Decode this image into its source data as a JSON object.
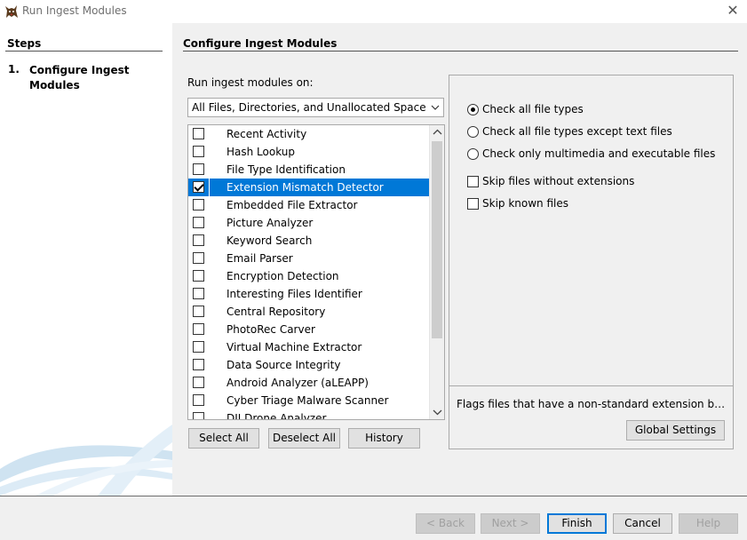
{
  "window": {
    "title": "Run Ingest Modules",
    "close_glyph": "✕"
  },
  "steps": {
    "title": "Steps",
    "items": [
      {
        "num": "1.",
        "label": "Configure Ingest Modules"
      }
    ]
  },
  "main": {
    "title": "Configure Ingest Modules",
    "run_label": "Run ingest modules on:",
    "run_select_value": "All Files, Directories, and Unallocated Space",
    "modules": [
      {
        "name": "Recent Activity",
        "checked": false,
        "selected": false
      },
      {
        "name": "Hash Lookup",
        "checked": false,
        "selected": false
      },
      {
        "name": "File Type Identification",
        "checked": false,
        "selected": false
      },
      {
        "name": "Extension Mismatch Detector",
        "checked": true,
        "selected": true
      },
      {
        "name": "Embedded File Extractor",
        "checked": false,
        "selected": false
      },
      {
        "name": "Picture Analyzer",
        "checked": false,
        "selected": false
      },
      {
        "name": "Keyword Search",
        "checked": false,
        "selected": false
      },
      {
        "name": "Email Parser",
        "checked": false,
        "selected": false
      },
      {
        "name": "Encryption Detection",
        "checked": false,
        "selected": false
      },
      {
        "name": "Interesting Files Identifier",
        "checked": false,
        "selected": false
      },
      {
        "name": "Central Repository",
        "checked": false,
        "selected": false
      },
      {
        "name": "PhotoRec Carver",
        "checked": false,
        "selected": false
      },
      {
        "name": "Virtual Machine Extractor",
        "checked": false,
        "selected": false
      },
      {
        "name": "Data Source Integrity",
        "checked": false,
        "selected": false
      },
      {
        "name": "Android Analyzer (aLEAPP)",
        "checked": false,
        "selected": false
      },
      {
        "name": "Cyber Triage Malware Scanner",
        "checked": false,
        "selected": false
      },
      {
        "name": "DJI Drone Analyzer",
        "checked": false,
        "selected": false
      }
    ],
    "buttons": {
      "select_all": "Select All",
      "deselect_all": "Deselect All",
      "history": "History"
    }
  },
  "settings": {
    "radios": [
      {
        "label": "Check all file types",
        "selected": true
      },
      {
        "label": "Check all file types except text files",
        "selected": false
      },
      {
        "label": "Check only multimedia and executable files",
        "selected": false
      }
    ],
    "checks": [
      {
        "label": "Skip files without extensions",
        "checked": false
      },
      {
        "label": "Skip known files",
        "checked": false
      }
    ],
    "description": "Flags files that have a non-standard extension based on their file type.",
    "global_settings": "Global Settings"
  },
  "nav": {
    "back": "< Back",
    "next": "Next >",
    "finish": "Finish",
    "cancel": "Cancel",
    "help": "Help"
  },
  "colors": {
    "selection": "#0078d7"
  }
}
